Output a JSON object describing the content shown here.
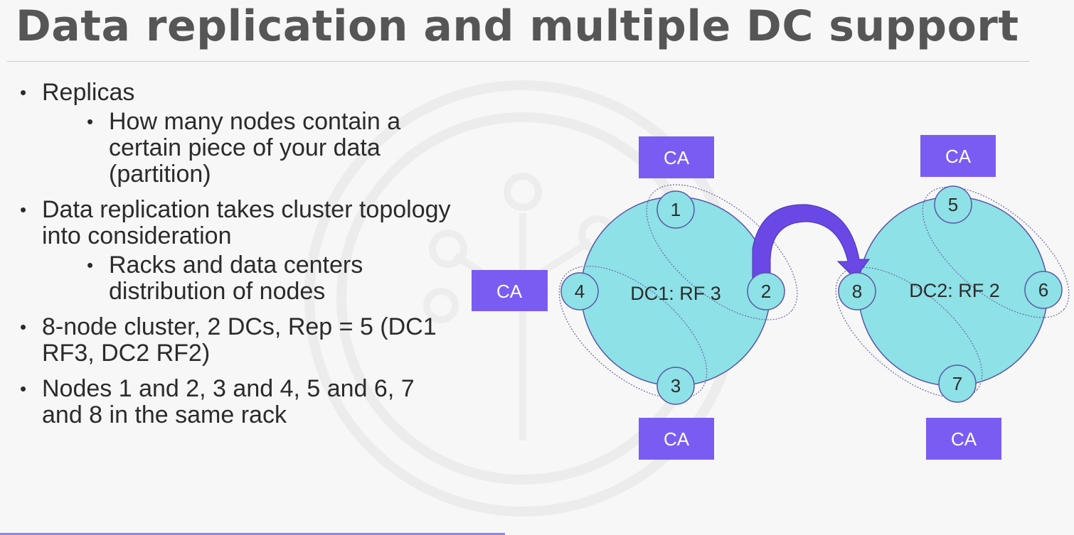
{
  "slide": {
    "title": "Data replication and multiple DC support"
  },
  "bullets": [
    {
      "text": "Replicas",
      "sub": [
        "How many nodes contain a certain piece of your data (partition)"
      ]
    },
    {
      "text": "Data replication takes cluster topology into consideration",
      "sub": [
        "Racks and data centers distribution of nodes"
      ]
    },
    {
      "text": "8-node cluster, 2 DCs, Rep = 5 (DC1 RF3, DC2 RF2)",
      "sub": []
    },
    {
      "text": "Nodes 1 and 2, 3 and 4, 5 and 6, 7 and 8 in the same rack",
      "sub": []
    }
  ],
  "diagram": {
    "colors": {
      "ring_fill": "#8ee1e6",
      "ring_stroke": "#5a56a8",
      "ca_box": "#7b5cf2",
      "arrow": "#6a48e6"
    },
    "dc1": {
      "label": "DC1: RF 3",
      "nodes": [
        "1",
        "2",
        "3",
        "4"
      ],
      "clients": [
        "CA",
        "CA",
        "CA"
      ]
    },
    "dc2": {
      "label": "DC2: RF 2",
      "nodes": [
        "5",
        "6",
        "7",
        "8"
      ],
      "clients": [
        "CA",
        "CA"
      ]
    },
    "icons": {
      "arrow": "curved-arrow-right",
      "watermark": "tree-circuit-logo"
    }
  }
}
